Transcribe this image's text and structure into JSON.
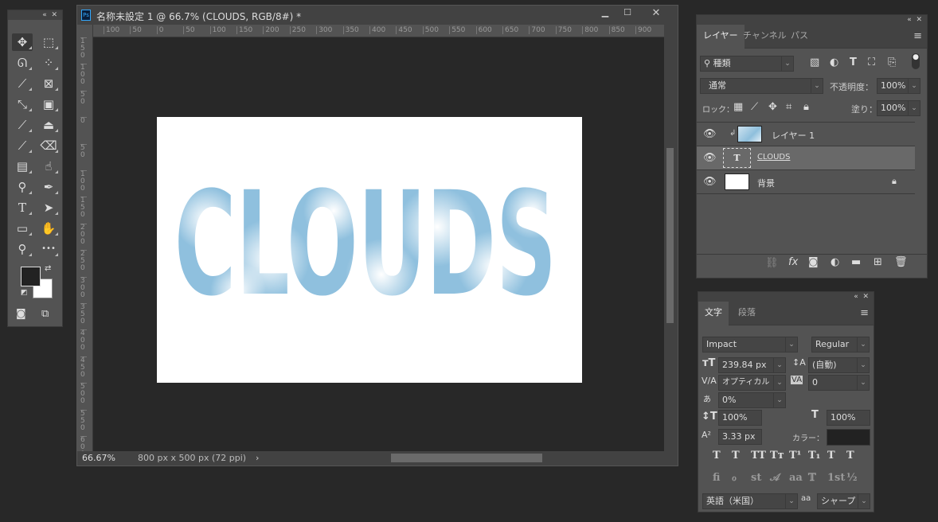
{
  "document": {
    "title": "名称未設定 1 @ 66.7% (CLOUDS, RGB/8#) *",
    "app_icon": "Ps",
    "zoom": "66.67%",
    "doc_info": "800 px x 500 px (72 ppi)",
    "canvas_text": "CLOUDS",
    "ruler_h": [
      "100",
      "50",
      "0",
      "50",
      "100",
      "150",
      "200",
      "250",
      "300",
      "350",
      "400",
      "450",
      "500",
      "550",
      "600",
      "650",
      "700",
      "750",
      "800",
      "850",
      "900"
    ],
    "ruler_v": [
      "150",
      "100",
      "50",
      "0",
      "50",
      "100",
      "150",
      "200",
      "250",
      "300",
      "350",
      "400",
      "450",
      "500",
      "550",
      "600"
    ]
  },
  "tools": [
    {
      "name": "move-tool",
      "glyph": "✥"
    },
    {
      "name": "marquee-tool",
      "glyph": "⬚"
    },
    {
      "name": "lasso-tool",
      "glyph": "ᘏ"
    },
    {
      "name": "quick-select-tool",
      "glyph": "⁘"
    },
    {
      "name": "slice-tool",
      "glyph": "⟋"
    },
    {
      "name": "frame-tool",
      "glyph": "⊠"
    },
    {
      "name": "eyedropper-tool",
      "glyph": "⤡"
    },
    {
      "name": "patch-tool",
      "glyph": "▣"
    },
    {
      "name": "brush-tool",
      "glyph": "⟋"
    },
    {
      "name": "stamp-tool",
      "glyph": "⏏"
    },
    {
      "name": "history-brush-tool",
      "glyph": "⟋"
    },
    {
      "name": "eraser-tool",
      "glyph": "⌫"
    },
    {
      "name": "gradient-tool",
      "glyph": "▤"
    },
    {
      "name": "smudge-tool",
      "glyph": "☝"
    },
    {
      "name": "dodge-tool",
      "glyph": "⚲"
    },
    {
      "name": "pen-tool",
      "glyph": "✒"
    },
    {
      "name": "type-tool",
      "glyph": "T"
    },
    {
      "name": "path-select-tool",
      "glyph": "➤"
    },
    {
      "name": "rectangle-tool",
      "glyph": "▭"
    },
    {
      "name": "hand-tool",
      "glyph": "✋"
    },
    {
      "name": "zoom-tool",
      "glyph": "⚲"
    },
    {
      "name": "more-tools",
      "glyph": "•••"
    }
  ],
  "colors": {
    "foreground": "#222222",
    "background": "#ffffff",
    "accent": "#535353"
  },
  "layers": {
    "tabs": [
      "レイヤー",
      "チャンネル",
      "パス"
    ],
    "filter": "種類",
    "blend": "通常",
    "opacity_label": "不透明度：",
    "opacity": "100%",
    "lock_label": "ロック：",
    "fill_label": "塗り：",
    "fill": "100%",
    "items": [
      {
        "name": "レイヤー 1",
        "type": "image",
        "clipped": true
      },
      {
        "name": "CLOUDS",
        "type": "text",
        "selected": true
      },
      {
        "name": "背景",
        "type": "background",
        "locked": true
      }
    ]
  },
  "character": {
    "tabs": [
      "文字",
      "段落"
    ],
    "font": "Impact",
    "style": "Regular",
    "size": "239.84 px",
    "leading": "(自動)",
    "kerning": "オプティカル",
    "tracking": "0",
    "tsume": "0%",
    "vscale": "100%",
    "hscale": "100%",
    "baseline": "3.33 px",
    "color_label": "カラー：",
    "color": "#222222",
    "language": "英語（米国）",
    "antialias": "シャープ",
    "aa_icon": "aa",
    "style_buttons": [
      "T",
      "T",
      "TT",
      "Tт",
      "T¹",
      "T₁",
      "T",
      "T"
    ],
    "opentype_buttons": [
      "fi",
      "ℴ",
      "st",
      "𝒜",
      "aa",
      "𝕋",
      "1st",
      "½"
    ]
  }
}
